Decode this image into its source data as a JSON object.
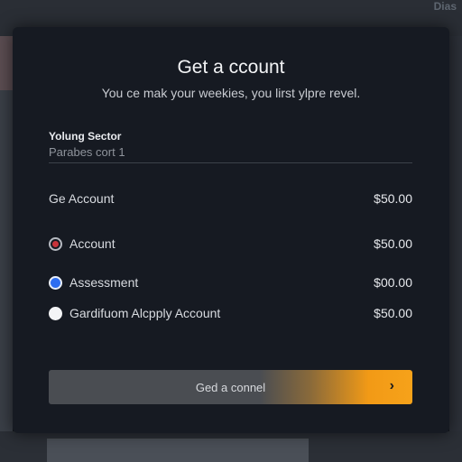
{
  "corner_text": "Dias",
  "dialog": {
    "title": "Get a ccount",
    "subtitle": "You ce mak your weekies, you lirst ylpre revel.",
    "field": {
      "label": "Yolung Sector",
      "value": "Parabes cort  1"
    },
    "options": [
      {
        "label": "Ge Account",
        "price": "$50.00",
        "radio": "none"
      },
      {
        "label": "Account",
        "price": "$50.00",
        "radio": "checked-red"
      },
      {
        "label": "Assessment",
        "price": "$00.00",
        "radio": "selected-blue"
      },
      {
        "label": "Gardifuom Alcpply Account",
        "price": "$50.00",
        "radio": "unselected-white"
      }
    ],
    "cta": {
      "label": "Ged a connel",
      "icon": "chevron-right-icon"
    }
  },
  "colors": {
    "background": "#14171c",
    "dialog": "#161a22",
    "accent": "#f29a16",
    "radio_blue": "#2d6df0",
    "radio_red": "#c8333a"
  }
}
